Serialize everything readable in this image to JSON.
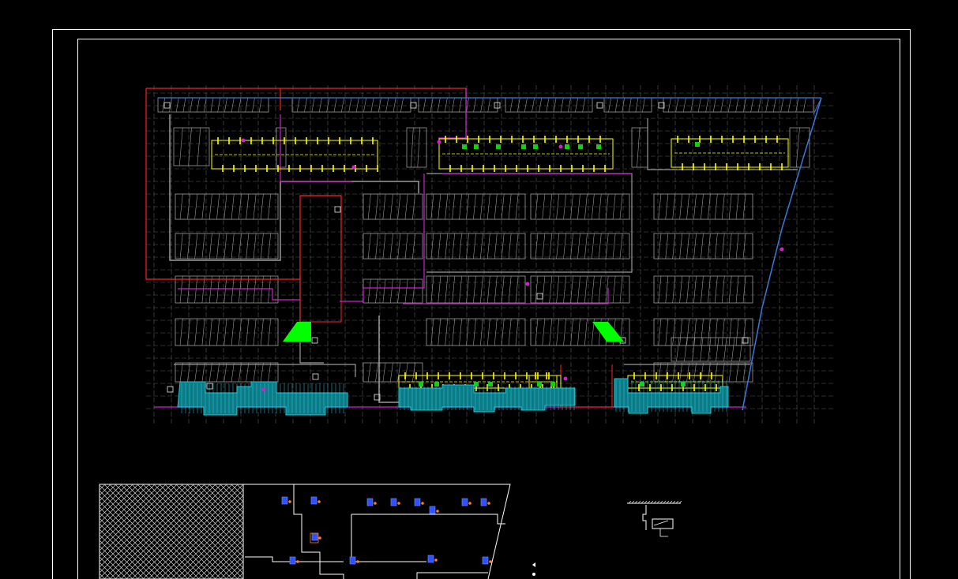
{
  "drawing": {
    "background": "#000000",
    "colors": {
      "frame": "#ffffff",
      "structure_grid": "#8c8c8c",
      "parking_bays": "#9a9a9a",
      "zone_red": "#ff2020",
      "zone_magenta": "#d020d0",
      "ramp_blue": "#3a7ad8",
      "ramp_fill": "#00ff00",
      "duct_yellow": "#ffff00",
      "equipment_cyan": "#20c8d8",
      "diffuser_blue": "#3050ff",
      "valve_orange": "#ff8020",
      "detail_white": "#e8e8e8"
    },
    "layers": [
      "frame",
      "grid",
      "parking",
      "zones",
      "ventilation",
      "equipment",
      "ramps",
      "legend-hatch",
      "system-diagram",
      "detail"
    ]
  }
}
